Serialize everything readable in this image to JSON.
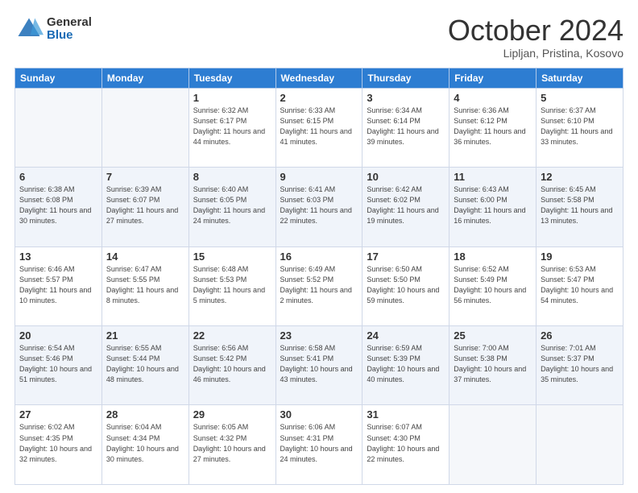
{
  "logo": {
    "general": "General",
    "blue": "Blue"
  },
  "header": {
    "month": "October 2024",
    "location": "Lipljan, Pristina, Kosovo"
  },
  "weekdays": [
    "Sunday",
    "Monday",
    "Tuesday",
    "Wednesday",
    "Thursday",
    "Friday",
    "Saturday"
  ],
  "days": [
    {
      "date": "",
      "info": ""
    },
    {
      "date": "",
      "info": ""
    },
    {
      "date": "1",
      "sunrise": "6:32 AM",
      "sunset": "6:17 PM",
      "daylight": "11 hours and 44 minutes."
    },
    {
      "date": "2",
      "sunrise": "6:33 AM",
      "sunset": "6:15 PM",
      "daylight": "11 hours and 41 minutes."
    },
    {
      "date": "3",
      "sunrise": "6:34 AM",
      "sunset": "6:14 PM",
      "daylight": "11 hours and 39 minutes."
    },
    {
      "date": "4",
      "sunrise": "6:36 AM",
      "sunset": "6:12 PM",
      "daylight": "11 hours and 36 minutes."
    },
    {
      "date": "5",
      "sunrise": "6:37 AM",
      "sunset": "6:10 PM",
      "daylight": "11 hours and 33 minutes."
    },
    {
      "date": "6",
      "sunrise": "6:38 AM",
      "sunset": "6:08 PM",
      "daylight": "11 hours and 30 minutes."
    },
    {
      "date": "7",
      "sunrise": "6:39 AM",
      "sunset": "6:07 PM",
      "daylight": "11 hours and 27 minutes."
    },
    {
      "date": "8",
      "sunrise": "6:40 AM",
      "sunset": "6:05 PM",
      "daylight": "11 hours and 24 minutes."
    },
    {
      "date": "9",
      "sunrise": "6:41 AM",
      "sunset": "6:03 PM",
      "daylight": "11 hours and 22 minutes."
    },
    {
      "date": "10",
      "sunrise": "6:42 AM",
      "sunset": "6:02 PM",
      "daylight": "11 hours and 19 minutes."
    },
    {
      "date": "11",
      "sunrise": "6:43 AM",
      "sunset": "6:00 PM",
      "daylight": "11 hours and 16 minutes."
    },
    {
      "date": "12",
      "sunrise": "6:45 AM",
      "sunset": "5:58 PM",
      "daylight": "11 hours and 13 minutes."
    },
    {
      "date": "13",
      "sunrise": "6:46 AM",
      "sunset": "5:57 PM",
      "daylight": "11 hours and 10 minutes."
    },
    {
      "date": "14",
      "sunrise": "6:47 AM",
      "sunset": "5:55 PM",
      "daylight": "11 hours and 8 minutes."
    },
    {
      "date": "15",
      "sunrise": "6:48 AM",
      "sunset": "5:53 PM",
      "daylight": "11 hours and 5 minutes."
    },
    {
      "date": "16",
      "sunrise": "6:49 AM",
      "sunset": "5:52 PM",
      "daylight": "11 hours and 2 minutes."
    },
    {
      "date": "17",
      "sunrise": "6:50 AM",
      "sunset": "5:50 PM",
      "daylight": "10 hours and 59 minutes."
    },
    {
      "date": "18",
      "sunrise": "6:52 AM",
      "sunset": "5:49 PM",
      "daylight": "10 hours and 56 minutes."
    },
    {
      "date": "19",
      "sunrise": "6:53 AM",
      "sunset": "5:47 PM",
      "daylight": "10 hours and 54 minutes."
    },
    {
      "date": "20",
      "sunrise": "6:54 AM",
      "sunset": "5:46 PM",
      "daylight": "10 hours and 51 minutes."
    },
    {
      "date": "21",
      "sunrise": "6:55 AM",
      "sunset": "5:44 PM",
      "daylight": "10 hours and 48 minutes."
    },
    {
      "date": "22",
      "sunrise": "6:56 AM",
      "sunset": "5:42 PM",
      "daylight": "10 hours and 46 minutes."
    },
    {
      "date": "23",
      "sunrise": "6:58 AM",
      "sunset": "5:41 PM",
      "daylight": "10 hours and 43 minutes."
    },
    {
      "date": "24",
      "sunrise": "6:59 AM",
      "sunset": "5:39 PM",
      "daylight": "10 hours and 40 minutes."
    },
    {
      "date": "25",
      "sunrise": "7:00 AM",
      "sunset": "5:38 PM",
      "daylight": "10 hours and 37 minutes."
    },
    {
      "date": "26",
      "sunrise": "7:01 AM",
      "sunset": "5:37 PM",
      "daylight": "10 hours and 35 minutes."
    },
    {
      "date": "27",
      "sunrise": "6:02 AM",
      "sunset": "4:35 PM",
      "daylight": "10 hours and 32 minutes."
    },
    {
      "date": "28",
      "sunrise": "6:04 AM",
      "sunset": "4:34 PM",
      "daylight": "10 hours and 30 minutes."
    },
    {
      "date": "29",
      "sunrise": "6:05 AM",
      "sunset": "4:32 PM",
      "daylight": "10 hours and 27 minutes."
    },
    {
      "date": "30",
      "sunrise": "6:06 AM",
      "sunset": "4:31 PM",
      "daylight": "10 hours and 24 minutes."
    },
    {
      "date": "31",
      "sunrise": "6:07 AM",
      "sunset": "4:30 PM",
      "daylight": "10 hours and 22 minutes."
    },
    {
      "date": "",
      "info": ""
    },
    {
      "date": "",
      "info": ""
    }
  ]
}
